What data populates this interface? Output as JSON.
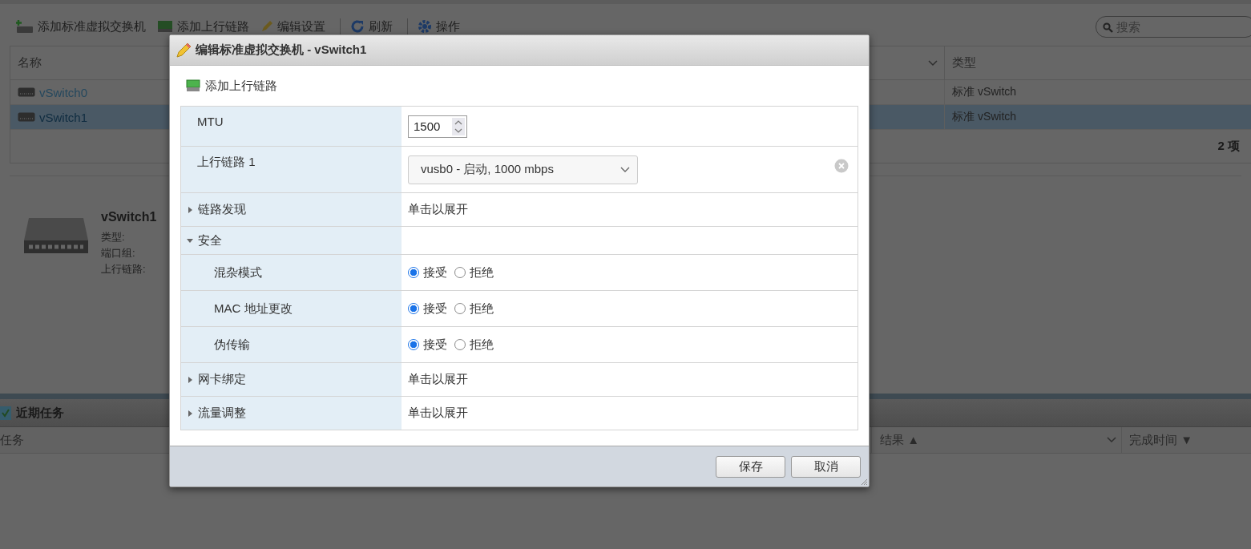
{
  "toolbar": [
    {
      "label": "添加标准虚拟交换机"
    },
    {
      "label": "添加上行链路"
    },
    {
      "label": "编辑设置"
    },
    {
      "label": "刷新"
    },
    {
      "label": "操作"
    }
  ],
  "search": {
    "placeholder": "搜索"
  },
  "table": {
    "columns": [
      "名称",
      "类型"
    ],
    "rows": [
      {
        "name": "vSwitch0",
        "type": "标准 vSwitch",
        "selected": false
      },
      {
        "name": "vSwitch1",
        "type": "标准 vSwitch",
        "selected": true
      }
    ],
    "count": "2 项"
  },
  "detail": {
    "title": "vSwitch1",
    "fields": [
      "类型:",
      "端口组:",
      "上行链路:"
    ]
  },
  "tasks": {
    "title": "近期任务",
    "columns": [
      "任务",
      "结果 ▲",
      "完成时间 ▼"
    ]
  },
  "dialog": {
    "title": "编辑标准虚拟交换机 - vSwitch1",
    "add_uplink": "添加上行链路",
    "rows": [
      {
        "kind": "number",
        "label": "MTU",
        "value": "1500"
      },
      {
        "kind": "select",
        "label": "上行链路 1",
        "value": "vusb0 - 启动, 1000 mbps"
      },
      {
        "kind": "section",
        "label": "链路发现",
        "expanded": false,
        "value": "单击以展开"
      },
      {
        "kind": "section",
        "label": "安全",
        "expanded": true,
        "children": [
          {
            "kind": "radio",
            "label": "混杂模式",
            "options": [
              {
                "label": "接受",
                "selected": true
              },
              {
                "label": "拒绝",
                "selected": false
              }
            ]
          },
          {
            "kind": "radio",
            "label": "MAC 地址更改",
            "options": [
              {
                "label": "接受",
                "selected": true
              },
              {
                "label": "拒绝",
                "selected": false
              }
            ]
          },
          {
            "kind": "radio",
            "label": "伪传输",
            "options": [
              {
                "label": "接受",
                "selected": true
              },
              {
                "label": "拒绝",
                "selected": false
              }
            ]
          }
        ]
      },
      {
        "kind": "section",
        "label": "网卡绑定",
        "expanded": false,
        "value": "单击以展开"
      },
      {
        "kind": "section",
        "label": "流量调整",
        "expanded": false,
        "value": "单击以展开"
      }
    ],
    "buttons": [
      "保存",
      "取消"
    ]
  }
}
